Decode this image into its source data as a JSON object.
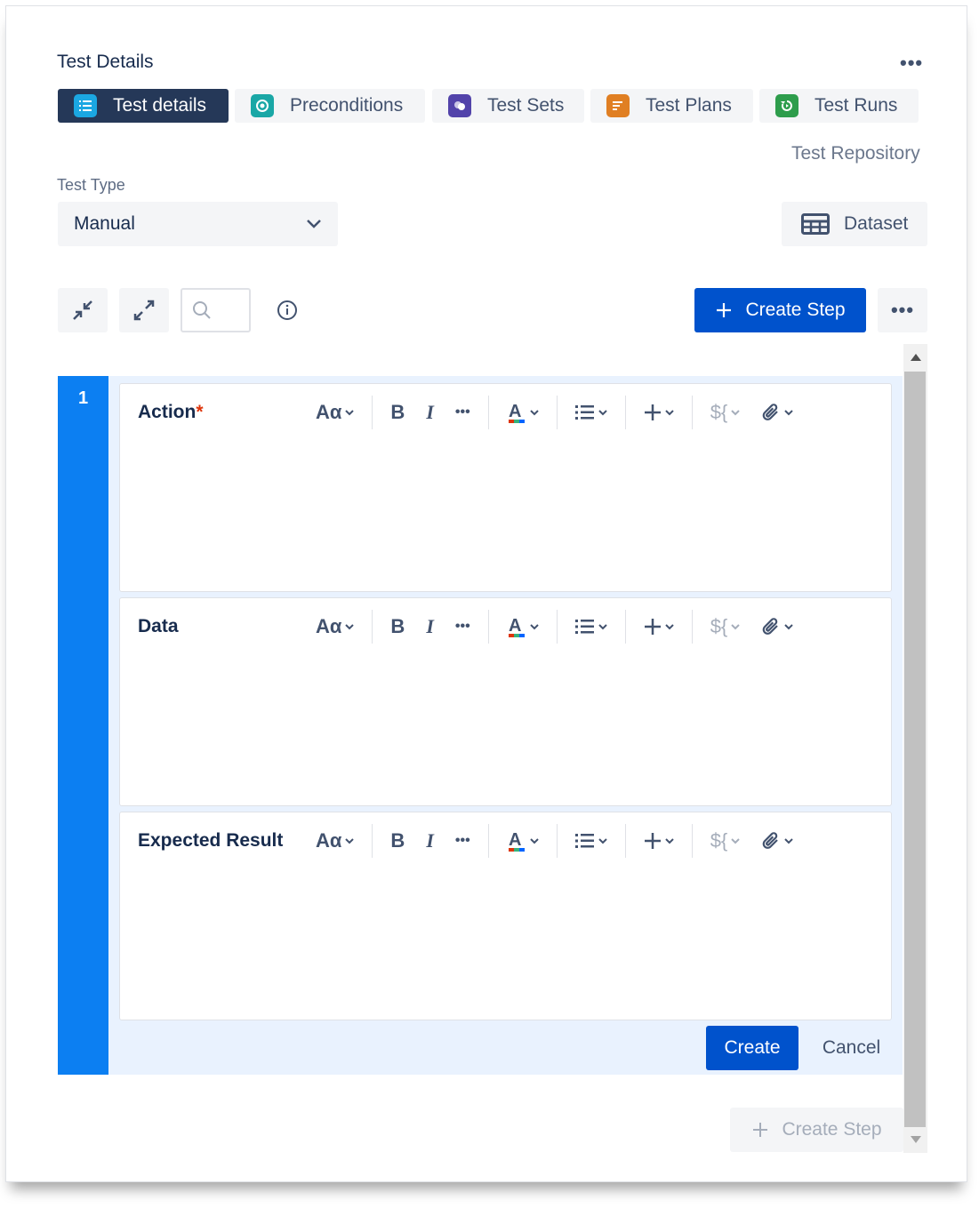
{
  "header": {
    "title": "Test Details",
    "more_label": "•••"
  },
  "tabs": [
    {
      "label": "Test details",
      "icon": "list-icon",
      "color": "#1ba7e2",
      "active": true
    },
    {
      "label": "Preconditions",
      "icon": "precondition-icon",
      "color": "#1aa7a6",
      "active": false
    },
    {
      "label": "Test Sets",
      "icon": "test-sets-icon",
      "color": "#5243aa",
      "active": false
    },
    {
      "label": "Test Plans",
      "icon": "test-plans-icon",
      "color": "#e07f23",
      "active": false
    },
    {
      "label": "Test Runs",
      "icon": "test-runs-icon",
      "color": "#2e9d4c",
      "active": false
    }
  ],
  "repo_link": "Test Repository",
  "test_type": {
    "label": "Test Type",
    "value": "Manual"
  },
  "dataset_label": "Dataset",
  "toolbar": {
    "create_step_label": "Create Step",
    "more_label": "•••"
  },
  "step": {
    "number": "1",
    "editors": [
      {
        "label": "Action",
        "required": "*"
      },
      {
        "label": "Data",
        "required": ""
      },
      {
        "label": "Expected Result",
        "required": ""
      }
    ],
    "format_text": "Aα",
    "bold": "B",
    "italic": "I",
    "more": "•••",
    "color_letter": "A",
    "variable": "${",
    "create_label": "Create",
    "cancel_label": "Cancel"
  },
  "bottom_create_step_label": "Create Step",
  "colors": {
    "primary": "#0052cc",
    "step_bar": "#0c7ff2",
    "active_tab": "#253858"
  }
}
